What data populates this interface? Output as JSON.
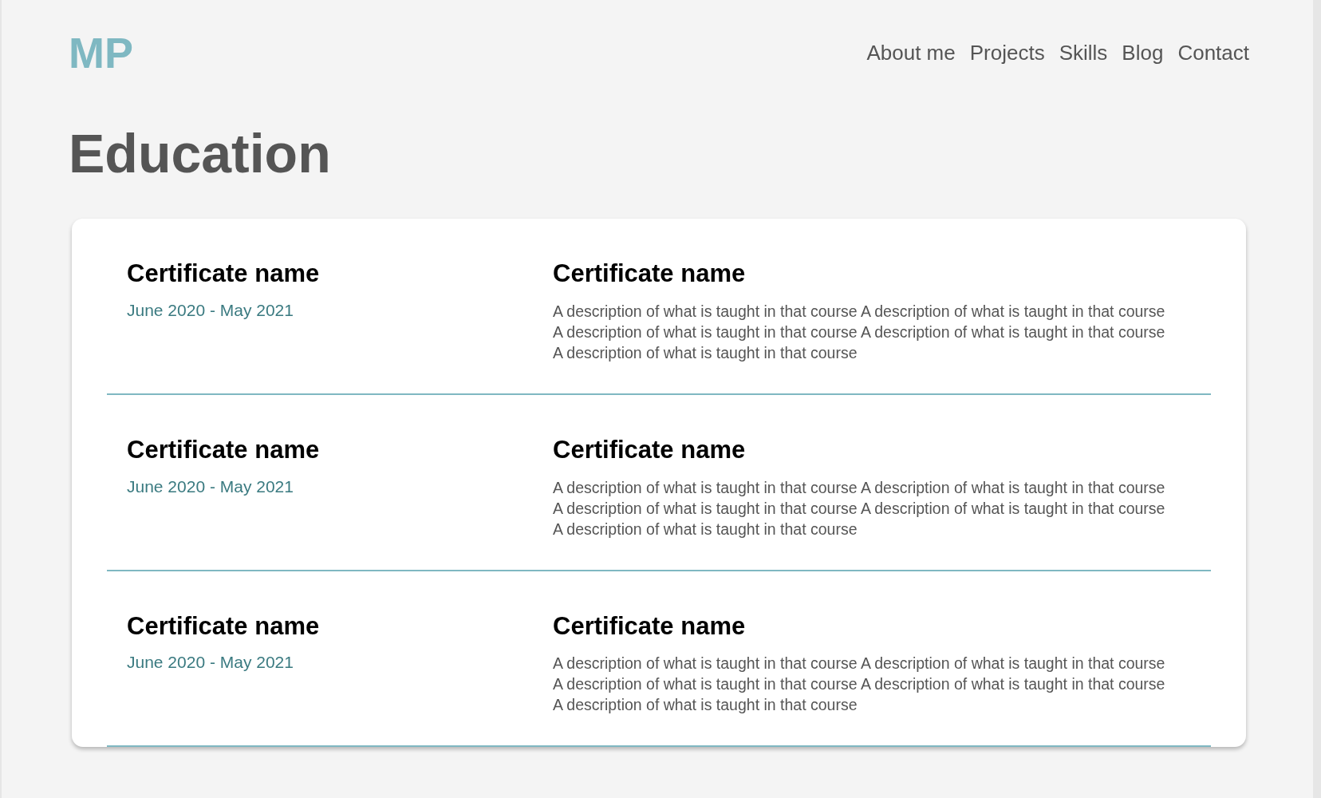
{
  "logo": "MP",
  "nav": [
    "About me",
    "Projects",
    "Skills",
    "Blog",
    "Contact"
  ],
  "heading": "Education",
  "entries": [
    {
      "name": "Certificate name",
      "dates": "June 2020 - May 2021",
      "title": "Certificate name",
      "description": "A description of what is taught in that course A description of what is taught in that course A description of what is taught in that course A description of what is taught in that course A description of what is taught in that course"
    },
    {
      "name": "Certificate name",
      "dates": "June 2020 - May 2021",
      "title": "Certificate name",
      "description": "A description of what is taught in that course A description of what is taught in that course A description of what is taught in that course A description of what is taught in that course A description of what is taught in that course"
    },
    {
      "name": "Certificate name",
      "dates": "June 2020 - May 2021",
      "title": "Certificate name",
      "description": "A description of what is taught in that course A description of what is taught in that course A description of what is taught in that course A description of what is taught in that course A description of what is taught in that course"
    }
  ]
}
